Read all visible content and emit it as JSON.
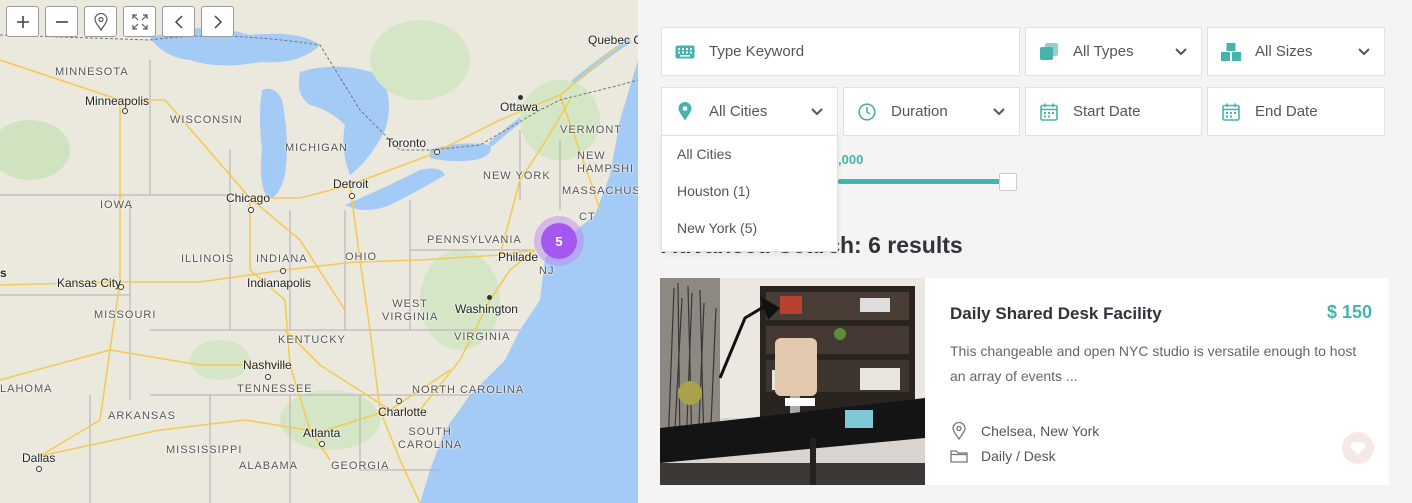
{
  "map": {
    "controls": [
      {
        "name": "zoom-in-button",
        "icon": "plus-icon"
      },
      {
        "name": "zoom-out-button",
        "icon": "minus-icon"
      },
      {
        "name": "locate-button",
        "icon": "map-pin-icon"
      },
      {
        "name": "fullscreen-button",
        "icon": "expand-icon"
      },
      {
        "name": "prev-button",
        "icon": "chevron-left-icon"
      },
      {
        "name": "next-button",
        "icon": "chevron-right-icon"
      }
    ],
    "cluster_count": "5",
    "cluster_color": "#a558ef",
    "labels": {
      "quebec": "Quebec C",
      "minnesota": "MINNESOTA",
      "minneapolis": "Minneapolis",
      "ottawa": "Ottawa",
      "wisconsin": "WISCONSIN",
      "vermont": "VERMONT",
      "toronto": "Toronto",
      "michigan": "MICHIGAN",
      "new_hampshire": "NEW\nHAMPSHI",
      "new_york_state": "NEW YORK",
      "detroit": "Detroit",
      "chicago": "Chicago",
      "massachusetts": "MASSACHUSE",
      "iowa": "IOWA",
      "ct": "CT",
      "pennsylvania": "PENNSYLVANIA",
      "illinois": "ILLINOIS",
      "indiana": "INDIANA",
      "ohio": "OHIO",
      "philadelphia": "Philade",
      "nj": "NJ",
      "kansas": "s",
      "kansas_city": "Kansas City",
      "indianapolis": "Indianapolis",
      "washington": "Washington",
      "west_virginia": "WEST\nVIRGINIA",
      "missouri": "MISSOURI",
      "virginia": "VIRGINIA",
      "kentucky": "KENTUCKY",
      "nashville": "Nashville",
      "oklahoma": "LAHOMA",
      "tennessee": "TENNESSEE",
      "north_carolina": "NORTH CAROLINA",
      "arkansas": "ARKANSAS",
      "charlotte": "Charlotte",
      "atlanta": "Atlanta",
      "south_carolina": "SOUTH\nCAROLINA",
      "mississippi": "MISSISSIPPI",
      "dallas": "Dallas",
      "alabama": "ALABAMA",
      "georgia": "GEORGIA"
    }
  },
  "search": {
    "keyword_placeholder": "Type Keyword",
    "types": "All Types",
    "sizes": "All Sizes",
    "cities": "All Cities",
    "duration": "Duration",
    "start_date": "Start Date",
    "end_date": "End Date",
    "city_options": [
      "All Cities",
      "Houston (1)",
      "New York (5)"
    ],
    "price_partial": ",000",
    "accent_color": "#46b3ad"
  },
  "results": {
    "heading": "Advanced Search: 6 results"
  },
  "listing": {
    "title": "Daily Shared Desk Facility",
    "price": "$ 150",
    "description": "This changeable and open NYC studio is versatile enough to host an array of events ...",
    "location": "Chelsea, New York",
    "category": "Daily / Desk",
    "icons": {
      "location": "map-pin-icon",
      "category": "folder-icon",
      "favorite": "heart-icon"
    }
  }
}
